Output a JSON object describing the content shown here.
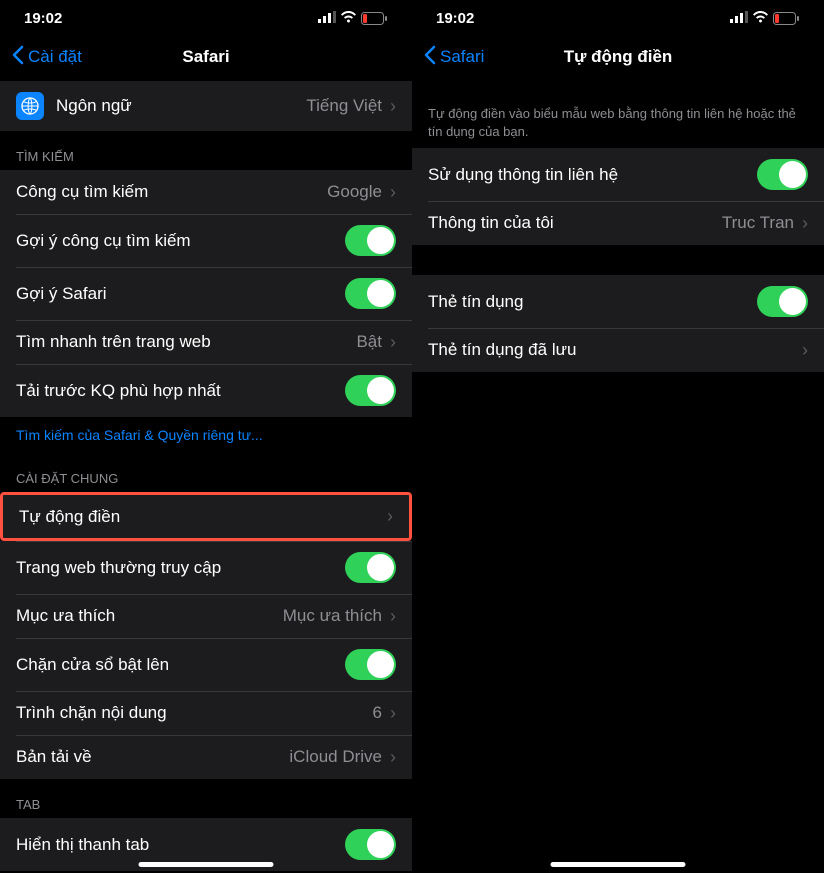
{
  "left": {
    "time": "19:02",
    "back_label": "Cài đặt",
    "title": "Safari",
    "lang_row": {
      "label": "Ngôn ngữ",
      "value": "Tiếng Việt"
    },
    "search_header": "TÌM KIẾM",
    "search_rows": {
      "engine": {
        "label": "Công cụ tìm kiếm",
        "value": "Google"
      },
      "engine_sugg": {
        "label": "Gợi ý công cụ tìm kiếm"
      },
      "safari_sugg": {
        "label": "Gợi ý Safari"
      },
      "quick_find": {
        "label": "Tìm nhanh trên trang web",
        "value": "Bật"
      },
      "preload": {
        "label": "Tải trước KQ phù hợp nhất"
      }
    },
    "search_footer": "Tìm kiếm của Safari & Quyền riêng tư...",
    "general_header": "CÀI ĐẶT CHUNG",
    "general_rows": {
      "autofill": {
        "label": "Tự động điền"
      },
      "freq_sites": {
        "label": "Trang web thường truy cập"
      },
      "favorites": {
        "label": "Mục ưa thích",
        "value": "Mục ưa thích"
      },
      "popup": {
        "label": "Chặn cửa sổ bật lên"
      },
      "blockers": {
        "label": "Trình chặn nội dung",
        "value": "6"
      },
      "downloads": {
        "label": "Bản tải về",
        "value": "iCloud Drive"
      }
    },
    "tab_header": "TAB",
    "tab_rows": {
      "show_bar": {
        "label": "Hiển thị thanh tab"
      }
    }
  },
  "right": {
    "time": "19:02",
    "back_label": "Safari",
    "title": "Tự động điền",
    "desc": "Tự động điền vào biểu mẫu web bằng thông tin liên hệ hoặc thẻ tín dụng của bạn.",
    "contact_rows": {
      "use_contact": {
        "label": "Sử dụng thông tin liên hệ"
      },
      "my_info": {
        "label": "Thông tin của tôi",
        "value": "Truc Tran"
      }
    },
    "card_rows": {
      "cards": {
        "label": "Thẻ tín dụng"
      },
      "saved_cards": {
        "label": "Thẻ tín dụng đã lưu"
      }
    }
  }
}
